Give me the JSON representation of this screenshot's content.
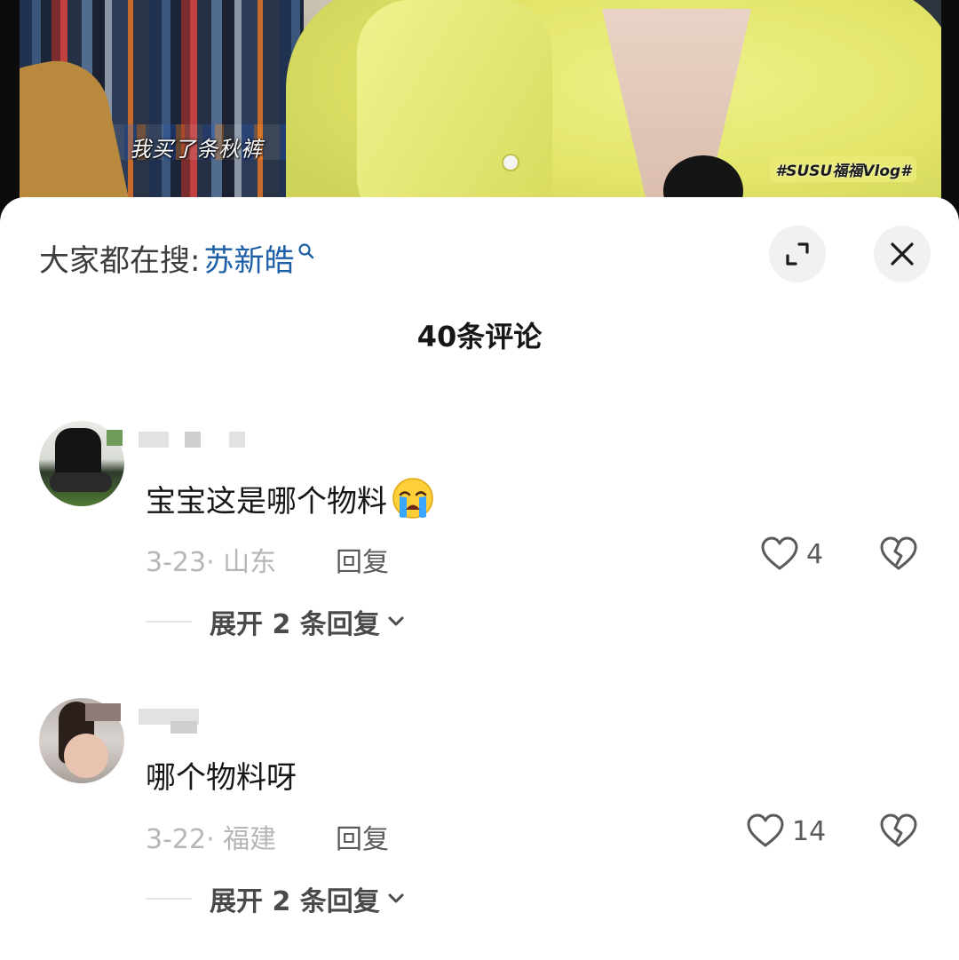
{
  "video": {
    "subtitle": "我买了条秋裤",
    "watermark": "#SUSU福福Vlog#"
  },
  "sheet": {
    "search_prefix": "大家都在搜:",
    "search_keyword": "苏新皓",
    "search_icon": "search-icon",
    "expand_icon": "fullscreen-icon",
    "close_icon": "close-icon",
    "comment_count_title": "40条评论"
  },
  "comments": [
    {
      "avatar_icon": "avatar",
      "text": "宝宝这是哪个物料",
      "emoji": "crying-face-emoji",
      "date_location": "3-23· 山东",
      "reply_label": "回复",
      "likes": "4",
      "expand_label": "展开 2 条回复"
    },
    {
      "avatar_icon": "avatar",
      "text": "哪个物料呀",
      "date_location": "3-22· 福建",
      "reply_label": "回复",
      "likes": "14",
      "expand_label": "展开 2 条回复"
    }
  ],
  "colors": {
    "link_blue": "#1d5fa6",
    "meta_gray": "#b6b6b6",
    "text_dark": "#161616"
  }
}
